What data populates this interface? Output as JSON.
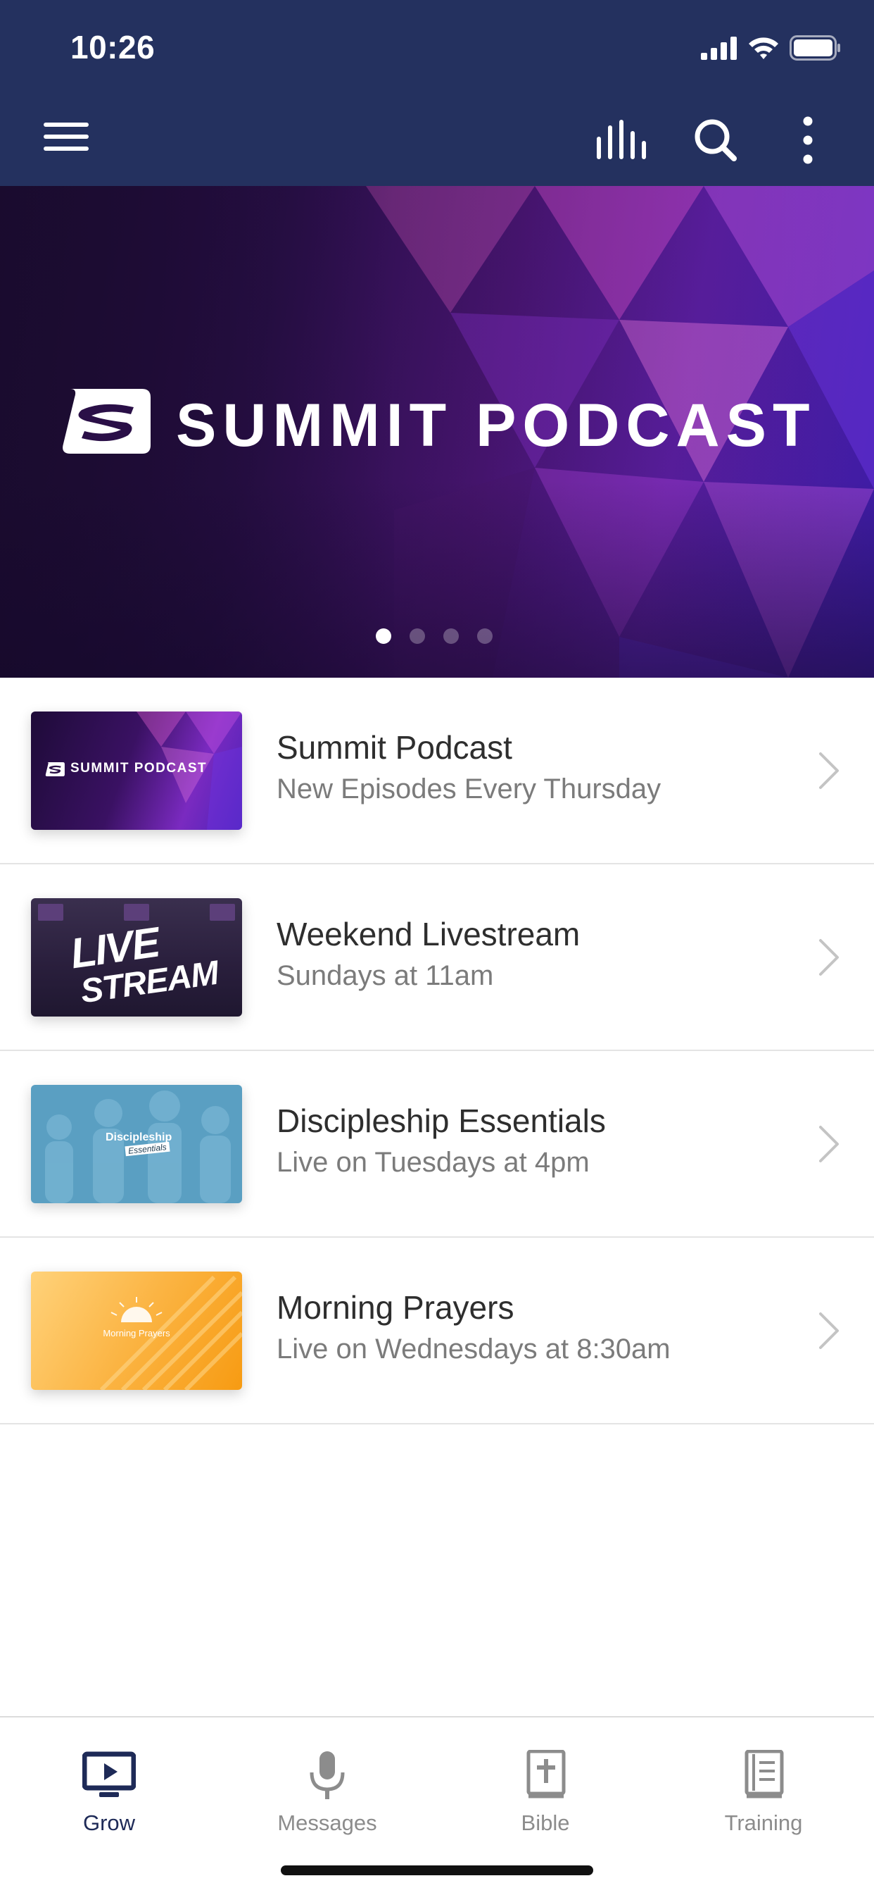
{
  "status_bar": {
    "time": "10:26"
  },
  "header": {
    "menu_icon": "hamburger-icon",
    "actions": [
      "bars-icon",
      "search-icon",
      "more-vertical-icon"
    ]
  },
  "hero": {
    "title": "SUMMIT PODCAST",
    "logo_icon": "summit-logo-icon",
    "dots_total": 4,
    "active_dot": 1
  },
  "list": {
    "items": [
      {
        "title": "Summit Podcast",
        "subtitle": "New Episodes Every Thursday",
        "thumb_text": "SUMMIT PODCAST",
        "chevron_icon": "chevron-right-icon"
      },
      {
        "title": "Weekend Livestream",
        "subtitle": "Sundays at 11am",
        "thumb_text_1": "LIVE",
        "thumb_text_2": "STREAM",
        "chevron_icon": "chevron-right-icon"
      },
      {
        "title": "Discipleship Essentials",
        "subtitle": "Live on Tuesdays at 4pm",
        "thumb_text_1": "Discipleship",
        "thumb_text_2": "Essentials",
        "chevron_icon": "chevron-right-icon"
      },
      {
        "title": "Morning Prayers",
        "subtitle": "Live on Wednesdays at 8:30am",
        "thumb_text": "Morning Prayers",
        "chevron_icon": "chevron-right-icon"
      }
    ]
  },
  "tabs": [
    {
      "label": "Grow",
      "icon": "tv-play-icon",
      "active": true
    },
    {
      "label": "Messages",
      "icon": "microphone-icon",
      "active": false
    },
    {
      "label": "Bible",
      "icon": "bible-icon",
      "active": false
    },
    {
      "label": "Training",
      "icon": "book-icon",
      "active": false
    }
  ],
  "colors": {
    "header_bg": "#24315f",
    "active_tab": "#1e2a57",
    "inactive_tab": "#8c8c8c"
  }
}
